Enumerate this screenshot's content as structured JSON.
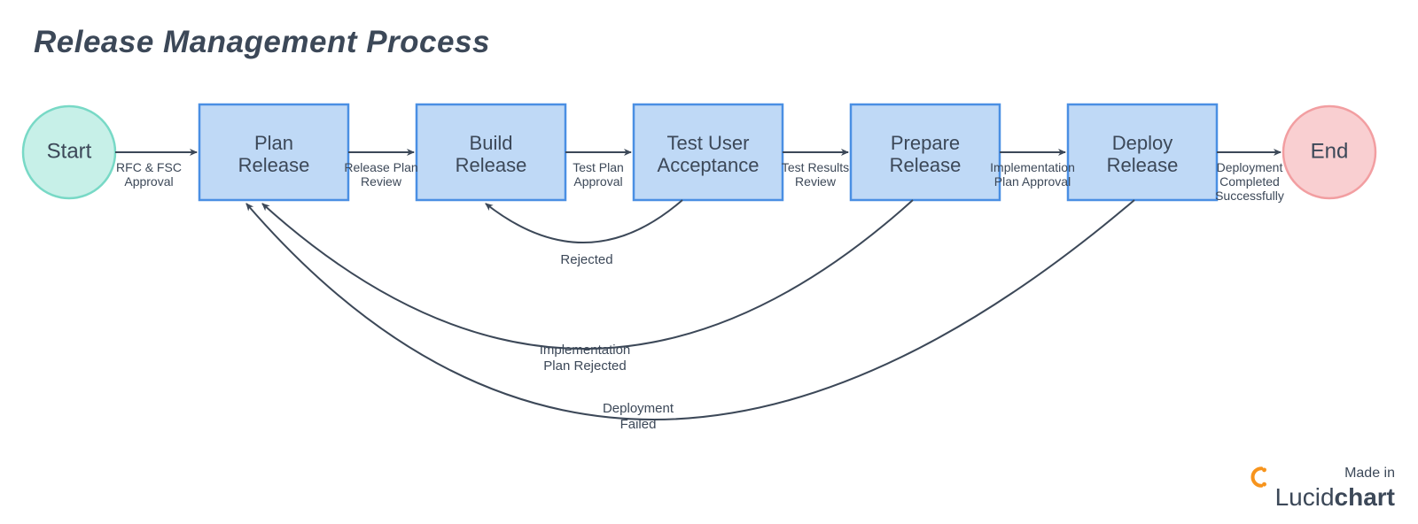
{
  "title": "Release Management Process",
  "terminators": {
    "start": "Start",
    "end": "End"
  },
  "nodes": {
    "plan": {
      "l1": "Plan",
      "l2": "Release"
    },
    "build": {
      "l1": "Build",
      "l2": "Release"
    },
    "test": {
      "l1": "Test User",
      "l2": "Acceptance"
    },
    "prepare": {
      "l1": "Prepare",
      "l2": "Release"
    },
    "deploy": {
      "l1": "Deploy",
      "l2": "Release"
    }
  },
  "edges": {
    "e1": {
      "l1": "RFC & FSC",
      "l2": "Approval"
    },
    "e2": {
      "l1": "Release Plan",
      "l2": "Review"
    },
    "e3": {
      "l1": "Test Plan",
      "l2": "Approval"
    },
    "e4": {
      "l1": "Test Results",
      "l2": "Review"
    },
    "e5": {
      "l1": "Implementation",
      "l2": "Plan Approval"
    },
    "e6": {
      "l1": "Deployment",
      "l2": "Completed",
      "l3": "Successfully"
    },
    "fb1": "Rejected",
    "fb2": {
      "l1": "Implementation",
      "l2": "Plan Rejected"
    },
    "fb3": {
      "l1": "Deployment",
      "l2": "Failed"
    }
  },
  "footer": {
    "made_in": "Made in",
    "brand_prefix": "Lucid",
    "brand_suffix": "chart"
  }
}
